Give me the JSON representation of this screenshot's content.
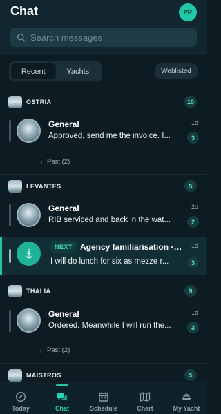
{
  "header": {
    "title": "Chat",
    "avatar_initials": "PR",
    "search_placeholder": "Search messages"
  },
  "tabs": [
    {
      "label": "Recent",
      "active": true
    },
    {
      "label": "Yachts",
      "active": false
    }
  ],
  "filter_chip": "Weblisted",
  "sections": [
    {
      "yacht": "OSTRIA",
      "count": "10",
      "threads": [
        {
          "title": "General",
          "message": "Approved, send me the invoice. I...",
          "time": "1d",
          "unread": "3"
        }
      ],
      "past": "Past (2)"
    },
    {
      "yacht": "LEVANTES",
      "count": "5",
      "threads": [
        {
          "title": "General",
          "message": "RIB serviced and back in the wat...",
          "time": "2d",
          "unread": "2"
        },
        {
          "tag": "NEXT",
          "title": "Agency familiarisation · L...",
          "message": "I will do lunch for six as mezze r...",
          "time": "1d",
          "unread": "3"
        }
      ]
    },
    {
      "yacht": "THALIA",
      "count": "9",
      "threads": [
        {
          "title": "General",
          "message": "Ordered. Meanwhile I will run the...",
          "time": "1d",
          "unread": "3"
        }
      ],
      "past": "Past (2)"
    },
    {
      "yacht": "MAISTROS",
      "count": "5"
    }
  ],
  "bottom_nav": [
    {
      "label": "Today",
      "icon": "compass-icon",
      "active": false
    },
    {
      "label": "Chat",
      "icon": "chat-bubbles-icon",
      "active": true
    },
    {
      "label": "Schedule",
      "icon": "calendar-icon",
      "active": false
    },
    {
      "label": "Chart",
      "icon": "map-icon",
      "active": false
    },
    {
      "label": "My Yacht",
      "icon": "yacht-icon",
      "active": false
    }
  ],
  "colors": {
    "background": "#0d1b22",
    "accent": "#20c7a9",
    "badge_bg": "#173c3e",
    "badge_text": "#5fe0c6"
  }
}
